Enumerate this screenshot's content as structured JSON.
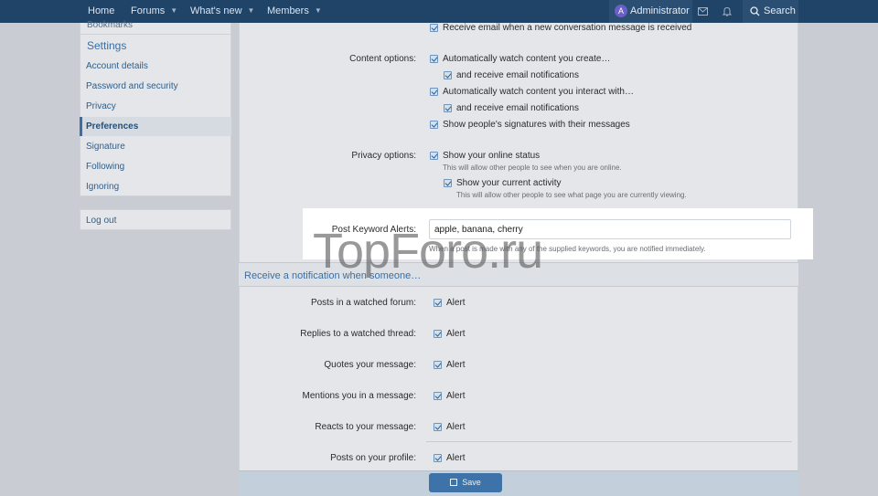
{
  "nav": {
    "home": "Home",
    "forums": "Forums",
    "whats_new": "What's new",
    "members": "Members",
    "user_initial": "A",
    "user_name": "Administrator",
    "search": "Search"
  },
  "sidebar": {
    "bookmarks": "Bookmarks",
    "section": "Settings",
    "items": [
      "Account details",
      "Password and security",
      "Privacy",
      "Preferences",
      "Signature",
      "Following",
      "Ignoring"
    ],
    "logout": "Log out"
  },
  "prefs": {
    "top_option": "Receive email when a new conversation message is received",
    "content_label": "Content options:",
    "content_opts": [
      "Automatically watch content you create…",
      "and receive email notifications",
      "Automatically watch content you interact with…",
      "and receive email notifications",
      "Show people's signatures with their messages"
    ],
    "privacy_label": "Privacy options:",
    "privacy_online": "Show your online status",
    "privacy_online_hint": "This will allow other people to see when you are online.",
    "privacy_activity": "Show your current activity",
    "privacy_activity_hint": "This will allow other people to see what page you are currently viewing.",
    "keyword_label": "Post Keyword Alerts:",
    "keyword_value": "apple, banana, cherry",
    "keyword_hint": "When a post is made with any of the supplied keywords, you are notified immediately."
  },
  "notify": {
    "heading": "Receive a notification when someone…",
    "alert_label": "Alert",
    "rows": [
      "Posts in a watched forum:",
      "Replies to a watched thread:",
      "Quotes your message:",
      "Mentions you in a message:",
      "Reacts to your message:",
      "Posts on your profile:"
    ]
  },
  "save_label": "Save",
  "watermark": "TopForo.ru",
  "colors": {
    "nav_bg": "#1f4468",
    "accent": "#3d73a8",
    "link": "#2f5e8a"
  }
}
